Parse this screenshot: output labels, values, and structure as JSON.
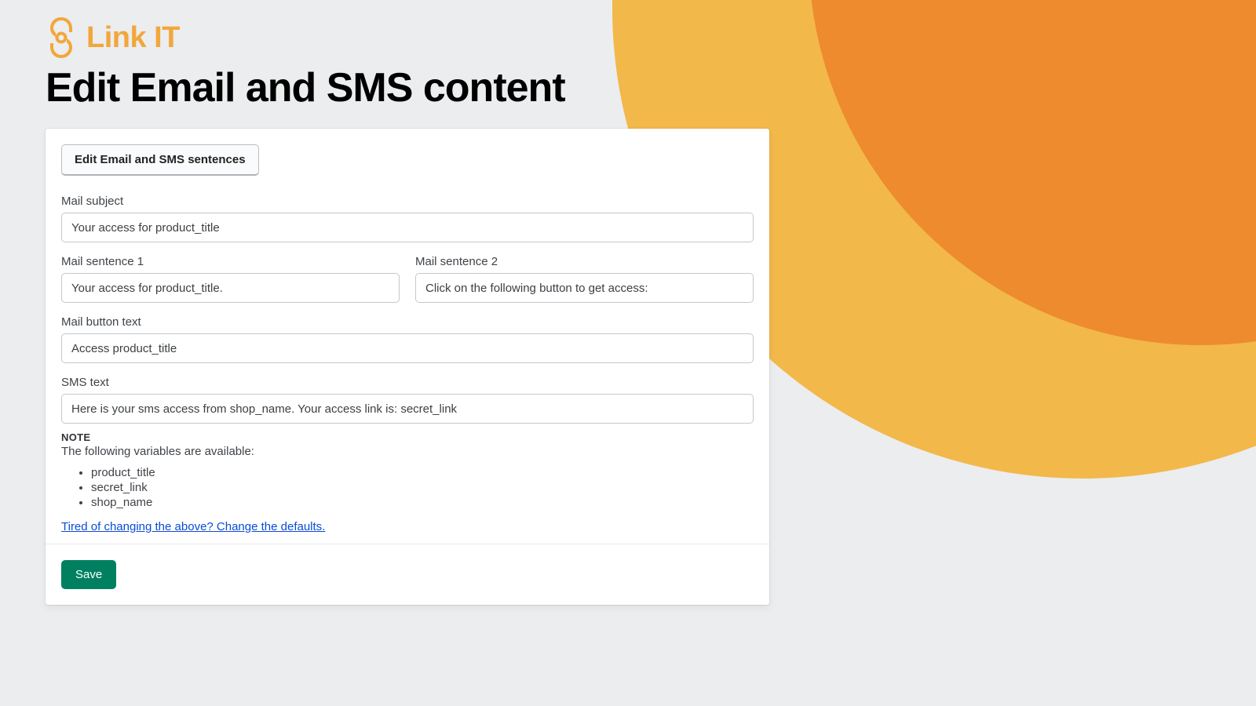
{
  "brand": {
    "name": "Link IT",
    "accent": "#f2a73b"
  },
  "page_title": "Edit Email and SMS content",
  "card": {
    "section_button": "Edit Email and SMS sentences",
    "fields": {
      "mail_subject": {
        "label": "Mail subject",
        "value": "Your access for product_title"
      },
      "mail_sentence_1": {
        "label": "Mail sentence 1",
        "value": "Your access for product_title."
      },
      "mail_sentence_2": {
        "label": "Mail sentence 2",
        "value": "Click on the following button to get access:"
      },
      "mail_button_text": {
        "label": "Mail button text",
        "value": "Access product_title"
      },
      "sms_text": {
        "label": "SMS text",
        "value": "Here is your sms access from shop_name. Your access link is: secret_link"
      }
    },
    "note": {
      "title": "NOTE",
      "intro": "The following variables are available:",
      "vars": [
        "product_title",
        "secret_link",
        "shop_name"
      ]
    },
    "defaults_link": "Tired of changing the above? Change the defaults.",
    "save_label": "Save"
  }
}
